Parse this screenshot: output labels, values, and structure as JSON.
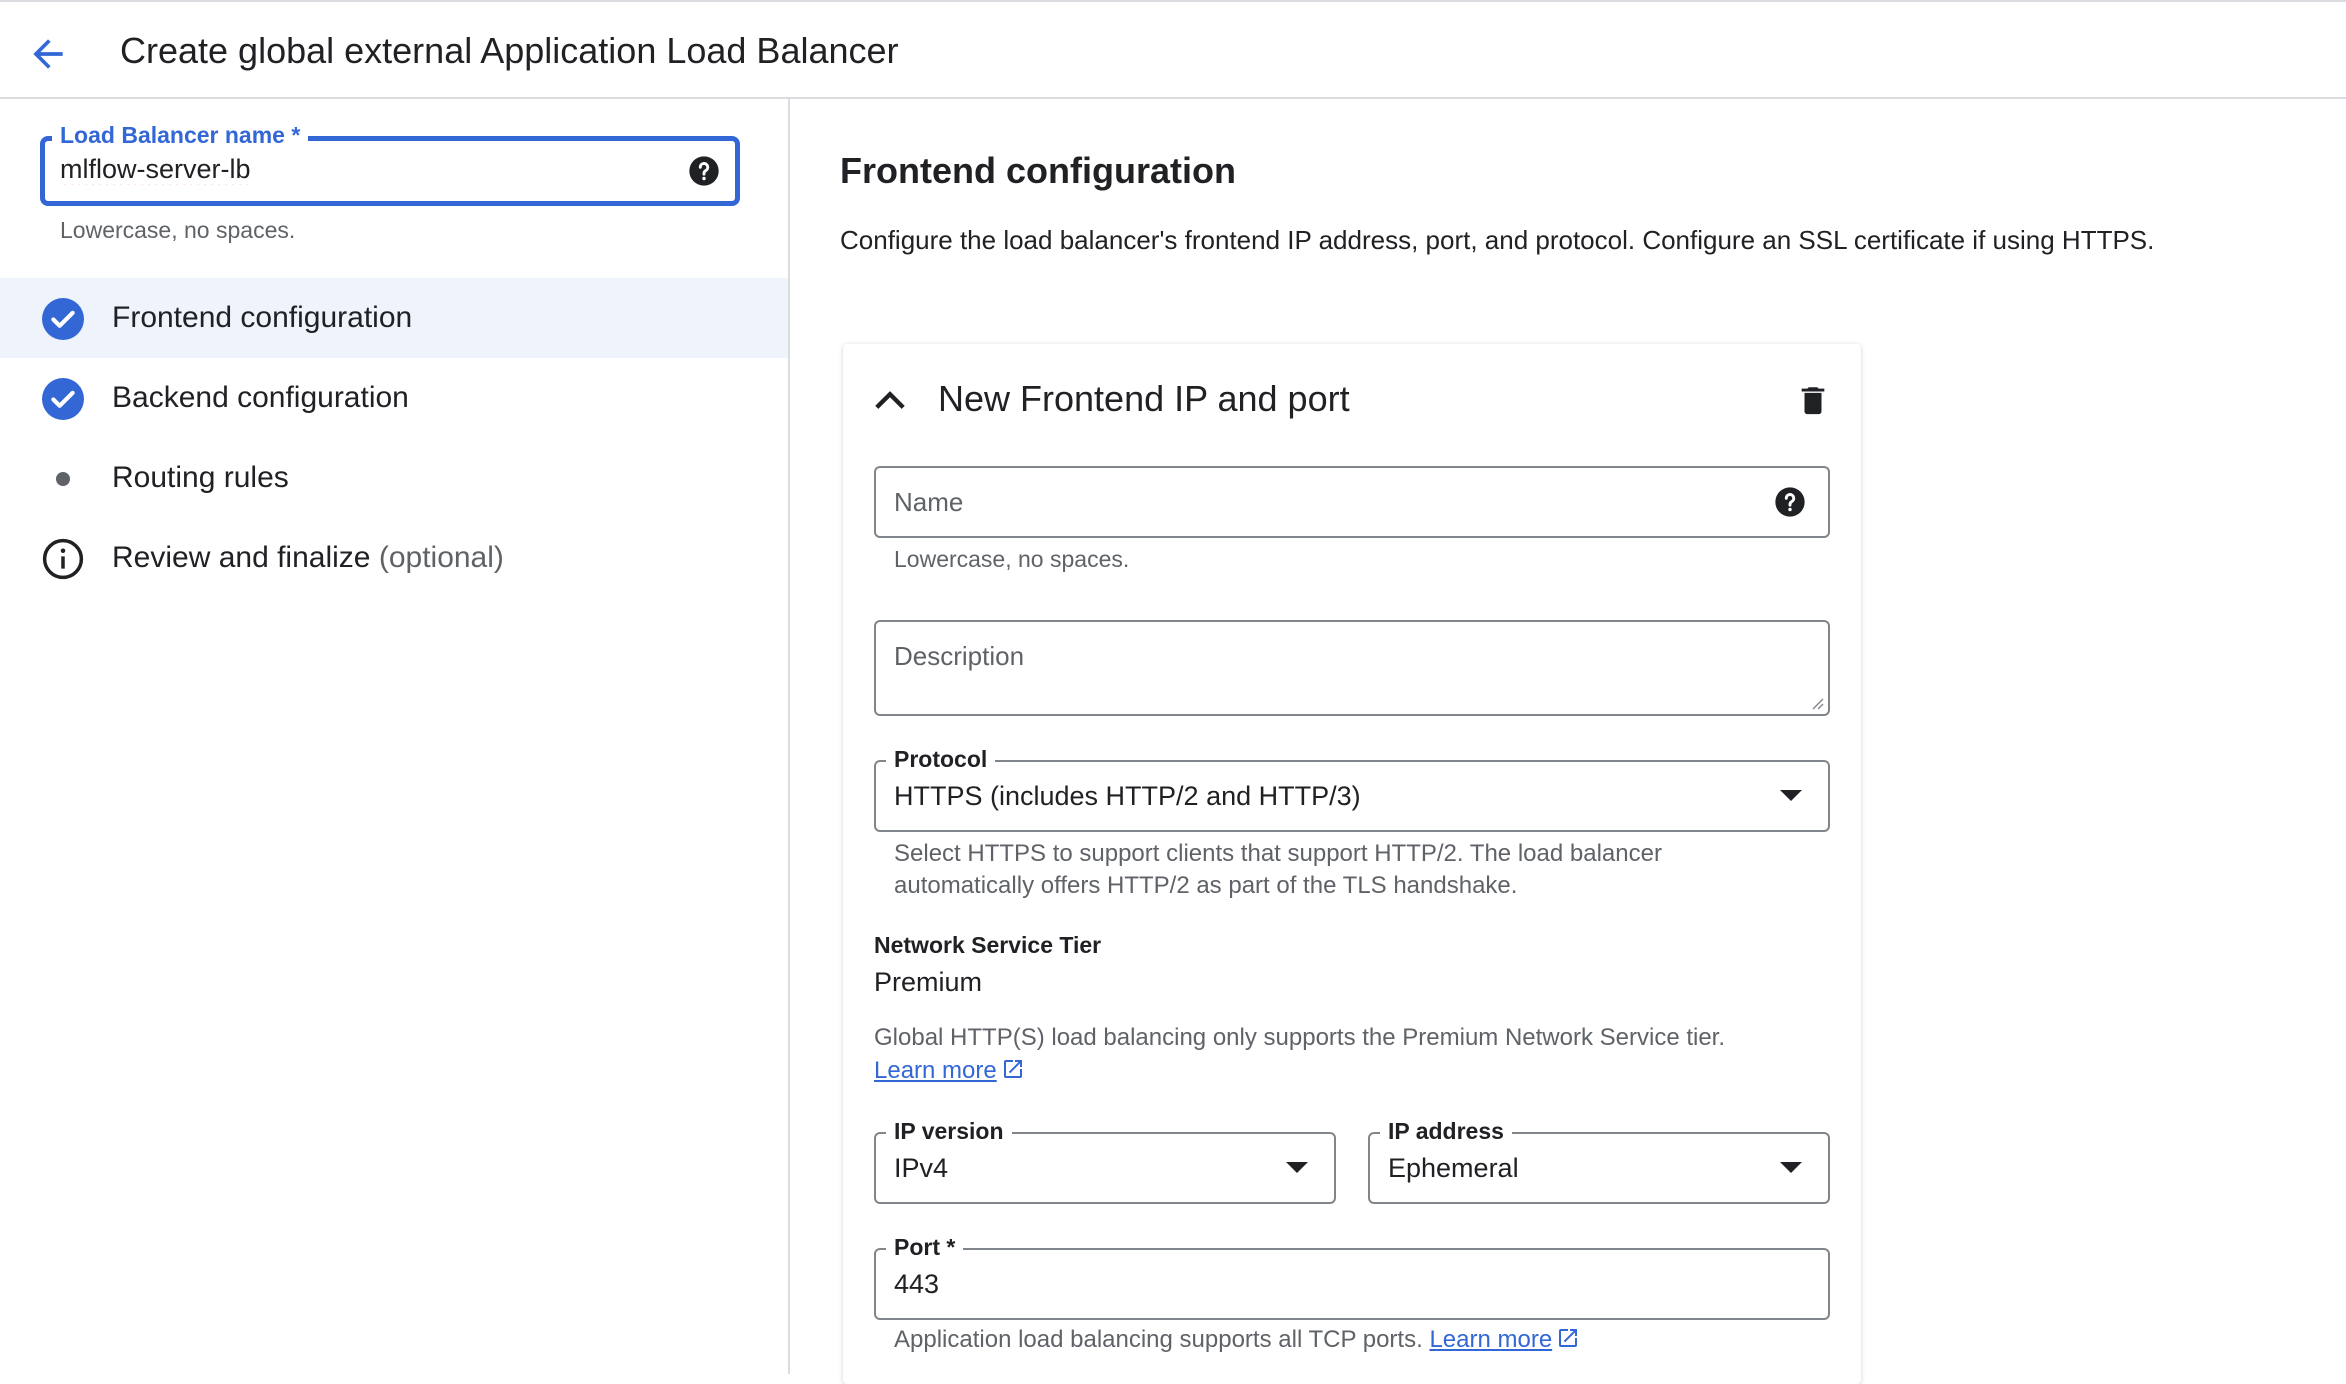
{
  "header": {
    "title": "Create global external Application Load Balancer"
  },
  "sidebar": {
    "lb_name": {
      "label": "Load Balancer name *",
      "value": "mlflow-server-lb",
      "hint": "Lowercase, no spaces."
    },
    "steps": [
      {
        "label": "Frontend configuration",
        "status": "complete"
      },
      {
        "label": "Backend configuration",
        "status": "complete"
      },
      {
        "label": "Routing rules",
        "status": "pending"
      },
      {
        "label": "Review and finalize",
        "optional": "(optional)",
        "status": "info"
      }
    ]
  },
  "main": {
    "title": "Frontend configuration",
    "description": "Configure the load balancer's frontend IP address, port, and protocol. Configure an SSL certificate if using HTTPS.",
    "card": {
      "title": "New Frontend IP and port",
      "name": {
        "placeholder": "Name",
        "hint": "Lowercase, no spaces."
      },
      "description": {
        "placeholder": "Description"
      },
      "protocol": {
        "label": "Protocol",
        "value": "HTTPS (includes HTTP/2 and HTTP/3)",
        "hint_line1": "Select HTTPS to support clients that support HTTP/2. The load balancer",
        "hint_line2": "automatically offers HTTP/2 as part of the TLS handshake."
      },
      "tier": {
        "label": "Network Service Tier",
        "value": "Premium",
        "note": "Global HTTP(S) load balancing only supports the Premium Network Service tier.",
        "link": "Learn more"
      },
      "ip_version": {
        "label": "IP version",
        "value": "IPv4"
      },
      "ip_address": {
        "label": "IP address",
        "value": "Ephemeral"
      },
      "port": {
        "label": "Port *",
        "value": "443",
        "hint": "Application load balancing supports all TCP ports.",
        "link": "Learn more"
      }
    }
  },
  "colors": {
    "accent": "#3367d6",
    "active_step_bg": "#eef3fc",
    "text": "#202124",
    "muted": "#5f6368"
  }
}
